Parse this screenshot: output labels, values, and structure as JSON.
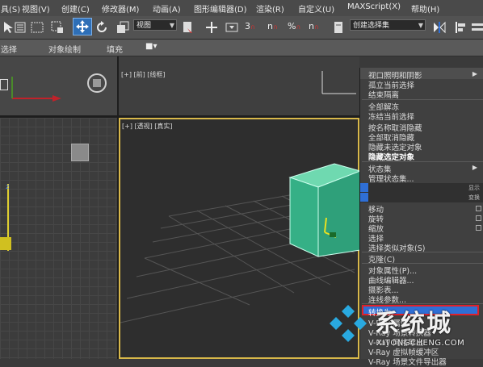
{
  "menubar": {
    "items": [
      "具(S)",
      "视图(V)",
      "创建(C)",
      "修改器(M)",
      "动画(A)",
      "图形编辑器(D)",
      "渲染(R)",
      "自定义(U)",
      "MAXScript(X)",
      "帮助(H)"
    ]
  },
  "toolbar": {
    "view_dropdown": "视图",
    "selection_set_dropdown": "创建选择集",
    "snap_label": "3",
    "angle_snap_label": "n",
    "percent_snap_label": "%",
    "spinner_snap_label": "n"
  },
  "ribbon": {
    "items": [
      "选择",
      "对象绘制",
      "填充"
    ]
  },
  "viewports": {
    "front_label": "[+] [前] [线框]",
    "perspective_label": "[+] [透视] [真实]"
  },
  "context_menu": {
    "items": [
      {
        "label": "视口照明和阴影",
        "submenu": true
      },
      {
        "label": "孤立当前选择"
      },
      {
        "label": "结束隔离"
      },
      {
        "label": "全部解冻"
      },
      {
        "label": "冻结当前选择"
      },
      {
        "label": "按名称取消隐藏"
      },
      {
        "label": "全部取消隐藏"
      },
      {
        "label": "隐藏未选定对象"
      },
      {
        "label": "隐藏选定对象",
        "bold": true
      },
      {
        "label": "状态集",
        "submenu": true
      },
      {
        "label": "管理状态集..."
      },
      {
        "label": "显示"
      },
      {
        "label": "变换"
      },
      {
        "label": "移动"
      },
      {
        "label": "旋转"
      },
      {
        "label": "缩放"
      },
      {
        "label": "选择"
      },
      {
        "label": "选择类似对象(S)"
      },
      {
        "label": "克隆(C)"
      },
      {
        "label": "对象属性(P)..."
      },
      {
        "label": "曲线编辑器..."
      },
      {
        "label": "摄影表..."
      },
      {
        "label": "连线参数..."
      },
      {
        "label": "转换为:"
      },
      {
        "label": "V-Ray 属性"
      },
      {
        "label": "V-Ray 场景转换器"
      },
      {
        "label": "V-Ray 网格导出"
      },
      {
        "label": "V-Ray 虚拟帧缓冲区"
      },
      {
        "label": "V-Ray 场景文件导出器"
      }
    ]
  },
  "watermark": {
    "title": "系统城",
    "url": "XITONGCHENG.COM"
  },
  "colors": {
    "highlight_outline": "#e0202a",
    "box_face": "#3bb88a",
    "panel_accent": "#2f6fd6"
  }
}
